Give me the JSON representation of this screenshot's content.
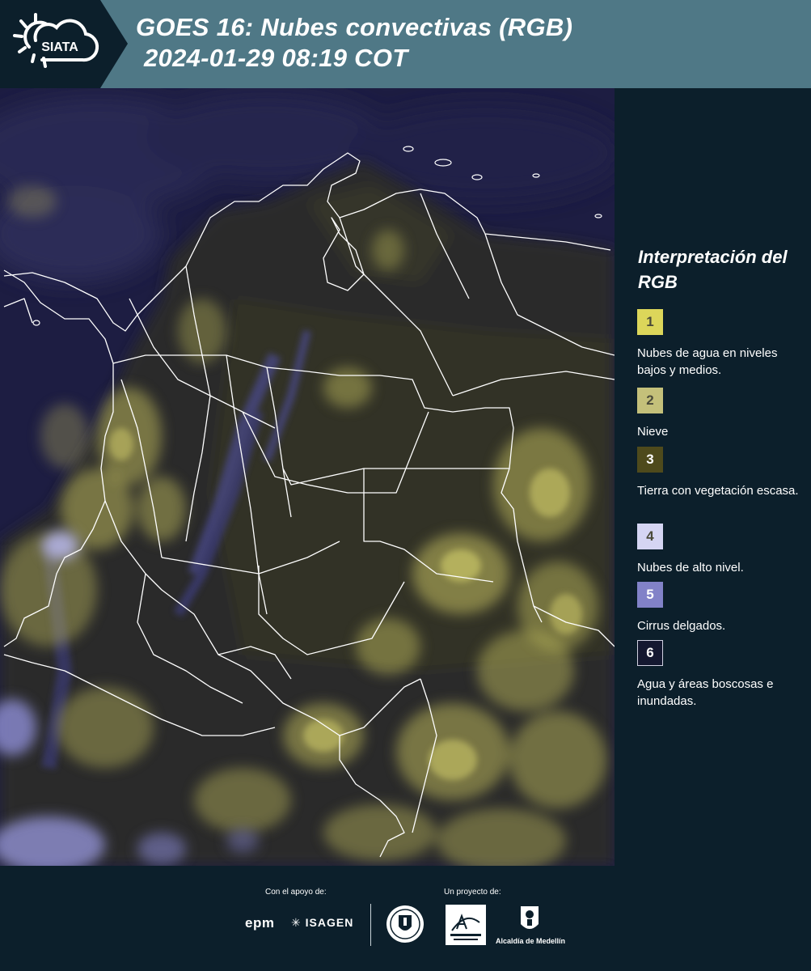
{
  "header": {
    "logo_text": "SIATA",
    "title_line1": "GOES 16: Nubes convectivas (RGB)",
    "title_line2": "2024-01-29 08:19 COT"
  },
  "colors": {
    "header_band": "#4f7886",
    "background": "#0c1f2b",
    "map_base": "#1d1d42",
    "boundary_lines": "#ffffff"
  },
  "legend": {
    "title": "Interpretación del RGB",
    "items": [
      {
        "number": "1",
        "label": "Nubes de agua en niveles bajos y medios.",
        "color": "#dcd65a"
      },
      {
        "number": "2",
        "label": "Nieve",
        "color": "#c4c07a"
      },
      {
        "number": "3",
        "label": "Tierra con vegetación escasa.",
        "color": "#4e4a1c"
      },
      {
        "number": "4",
        "label": "Nubes de alto nivel.",
        "color": "#d5d5f3"
      },
      {
        "number": "5",
        "label": "Cirrus delgados.",
        "color": "#8282c8"
      },
      {
        "number": "6",
        "label": "Agua y áreas boscosas e inundadas.",
        "color": "#141830"
      }
    ]
  },
  "footer": {
    "support_label": "Con el apoyo de:",
    "project_label": "Un proyecto de:",
    "sponsors": [
      "epm",
      "ISAGEN"
    ],
    "partners": [
      "Área Metropolitana Valle de Aburrá",
      "Alcaldía de Medellín"
    ],
    "alcaldia_label": "Alcaldía de Medellín"
  }
}
